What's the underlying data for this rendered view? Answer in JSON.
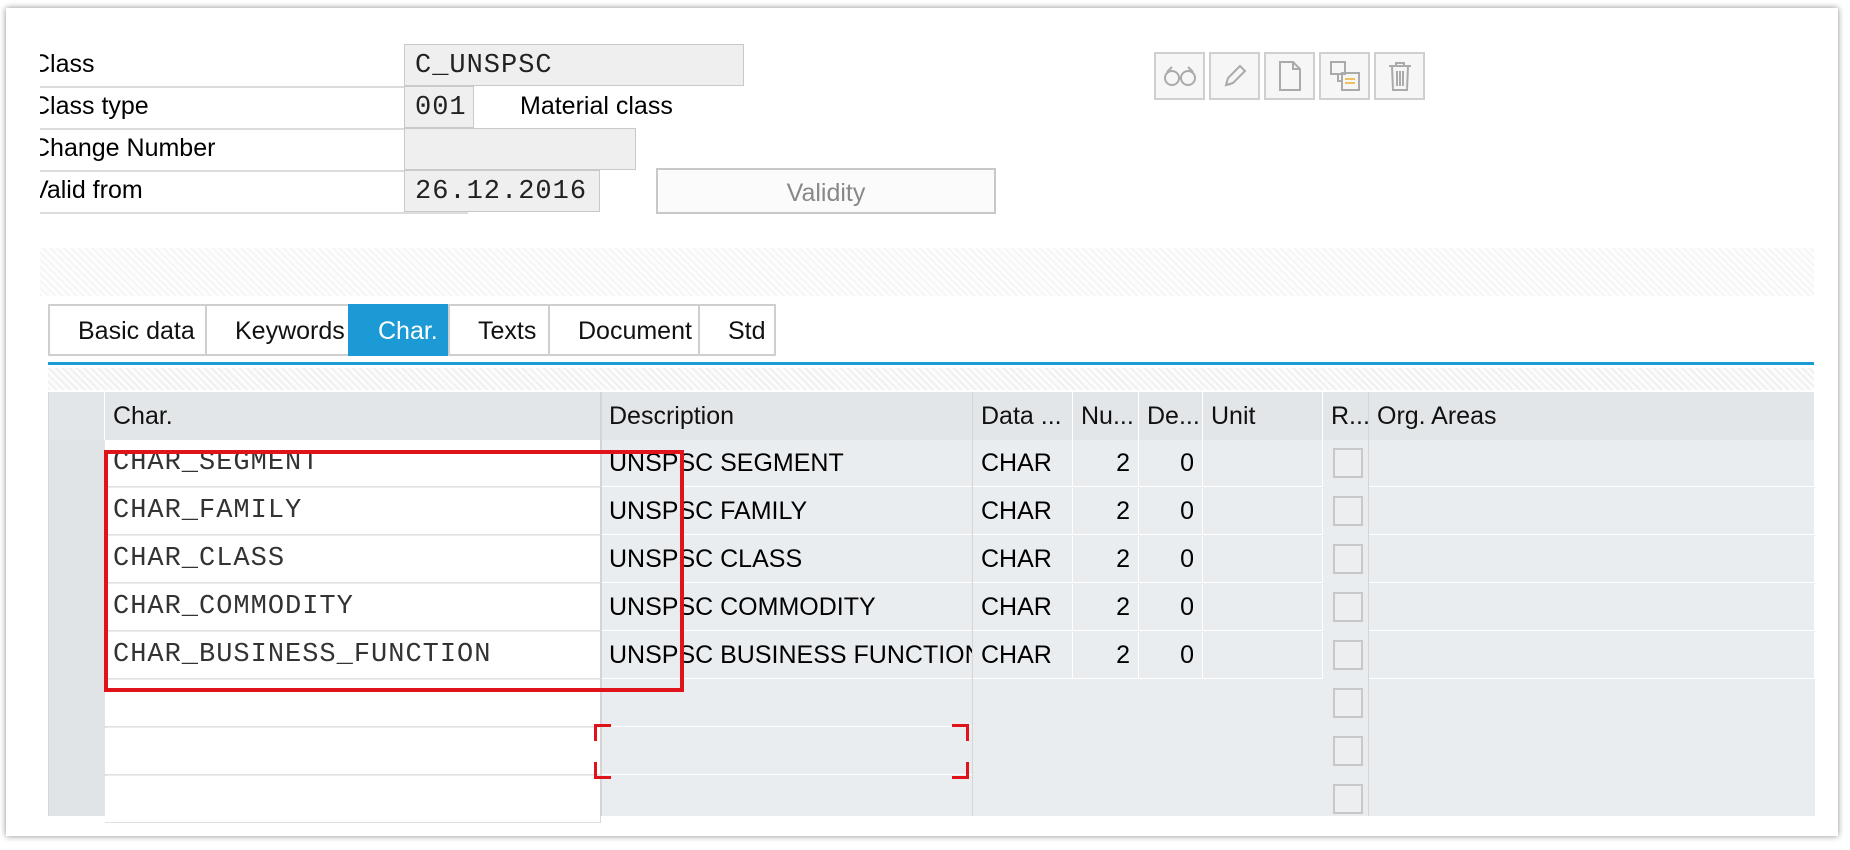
{
  "header": {
    "class_label": "Class",
    "class_value": "C_UNSPSC",
    "class_type_label": "Class type",
    "class_type_value": "001",
    "class_type_desc": "Material class",
    "change_number_label": "Change Number",
    "change_number_value": "",
    "valid_from_label": "Valid from",
    "valid_from_value": "26.12.2016",
    "validity_button": "Validity"
  },
  "toolbar": {
    "icons": [
      "display-icon",
      "edit-pencil-icon",
      "new-document-icon",
      "copy-icon",
      "delete-trash-icon"
    ]
  },
  "tabs": [
    {
      "label": "Basic data",
      "active": false
    },
    {
      "label": "Keywords",
      "active": false
    },
    {
      "label": "Char.",
      "active": true
    },
    {
      "label": "Texts",
      "active": false
    },
    {
      "label": "Document",
      "active": false
    },
    {
      "label": "Std",
      "active": false
    }
  ],
  "table": {
    "columns": [
      "Char.",
      "Description",
      "Data ...",
      "Nu...",
      "De...",
      "Unit",
      "R...",
      "Org. Areas"
    ],
    "rows": [
      {
        "char": "CHAR_SEGMENT",
        "description": "UNSPSC SEGMENT",
        "data_type": "CHAR",
        "num_chars": "2",
        "decimals": "0",
        "unit": "",
        "org_areas": ""
      },
      {
        "char": "CHAR_FAMILY",
        "description": "UNSPSC FAMILY",
        "data_type": "CHAR",
        "num_chars": "2",
        "decimals": "0",
        "unit": "",
        "org_areas": ""
      },
      {
        "char": "CHAR_CLASS",
        "description": "UNSPSC CLASS",
        "data_type": "CHAR",
        "num_chars": "2",
        "decimals": "0",
        "unit": "",
        "org_areas": ""
      },
      {
        "char": "CHAR_COMMODITY",
        "description": "UNSPSC COMMODITY",
        "data_type": "CHAR",
        "num_chars": "2",
        "decimals": "0",
        "unit": "",
        "org_areas": ""
      },
      {
        "char": "CHAR_BUSINESS_FUNCTION",
        "description": "UNSPSC BUSINESS FUNCTION",
        "data_type": "CHAR",
        "num_chars": "2",
        "decimals": "0",
        "unit": "",
        "org_areas": ""
      }
    ],
    "empty_rows": 3
  },
  "colors": {
    "accent": "#1c9ad6",
    "highlight": "#e0121a"
  }
}
